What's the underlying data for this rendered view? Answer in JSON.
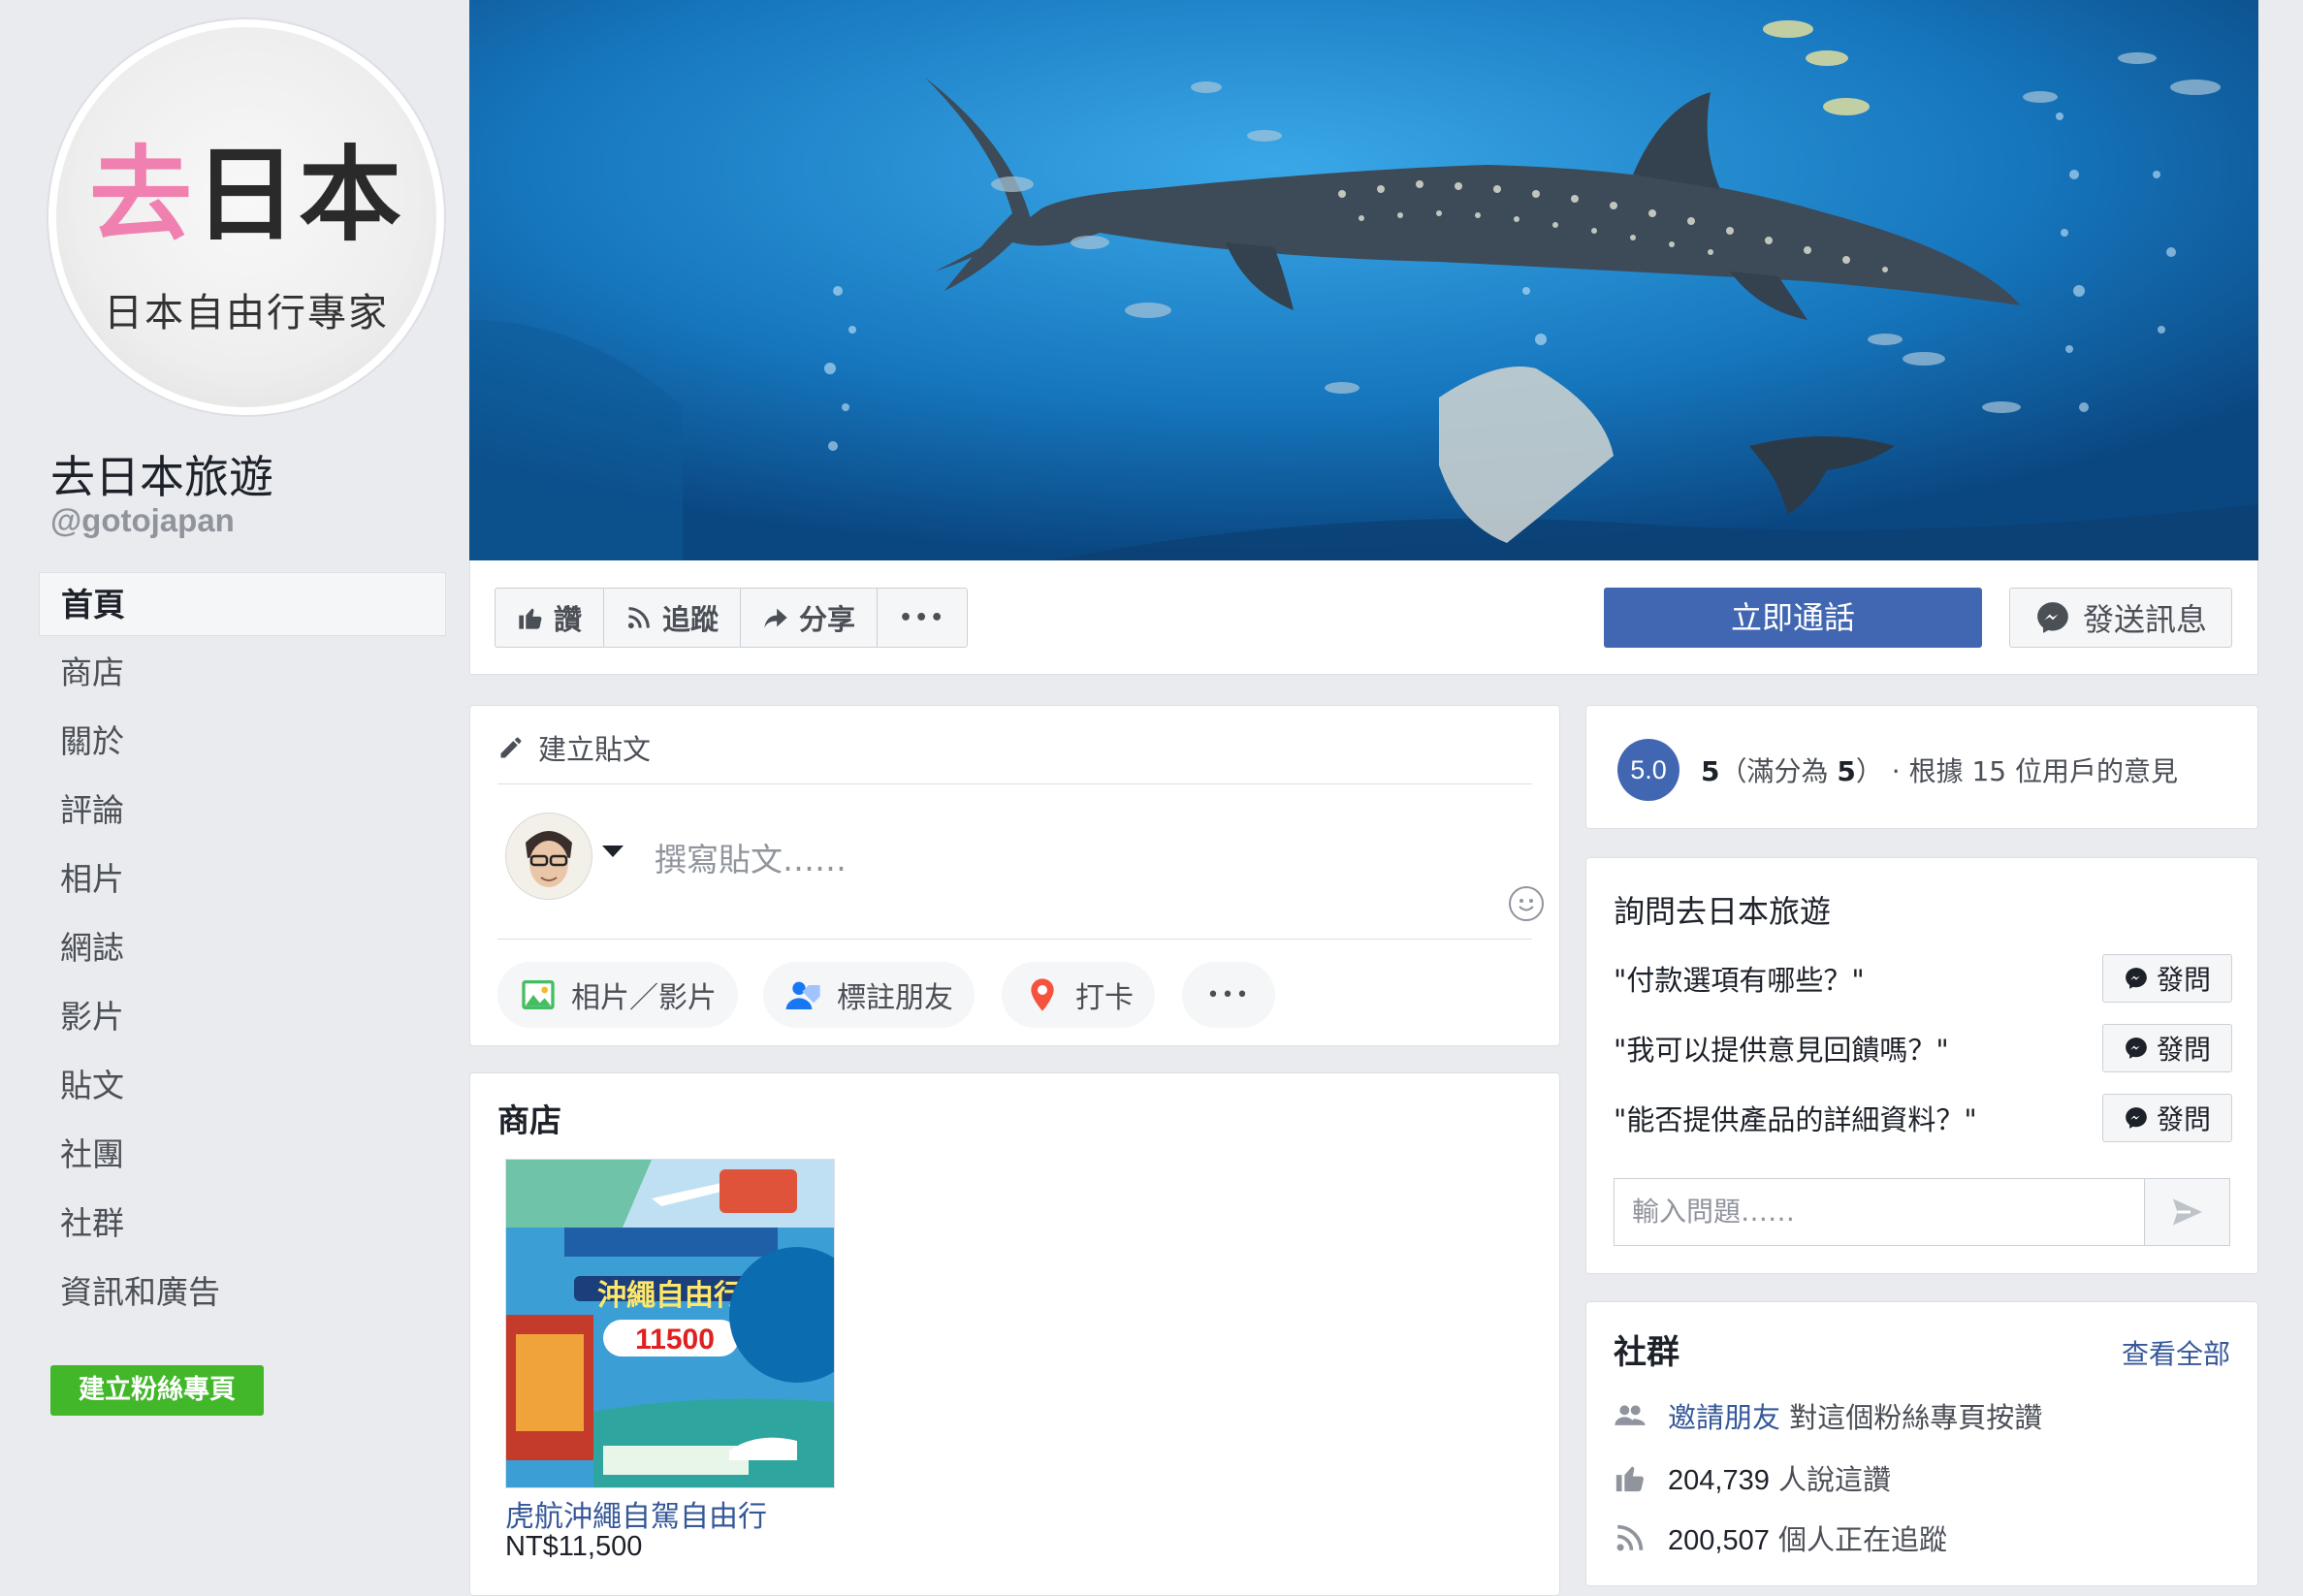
{
  "profile": {
    "logo_brand_pink": "去",
    "logo_brand_dark": "日本",
    "logo_tagline": "日本自由行專家",
    "name": "去日本旅遊",
    "handle": "@gotojapan"
  },
  "sidebar": {
    "items": [
      {
        "label": "首頁",
        "active": true
      },
      {
        "label": "商店"
      },
      {
        "label": "關於"
      },
      {
        "label": "評論"
      },
      {
        "label": "相片"
      },
      {
        "label": "網誌"
      },
      {
        "label": "影片"
      },
      {
        "label": "貼文"
      },
      {
        "label": "社團"
      },
      {
        "label": "社群"
      },
      {
        "label": "資訊和廣告"
      }
    ],
    "create_page_label": "建立粉絲專頁"
  },
  "actions": {
    "like": "讚",
    "follow": "追蹤",
    "share": "分享",
    "more": "•••",
    "call_now": "立即通話",
    "send_message": "發送訊息"
  },
  "composer": {
    "header": "建立貼文",
    "placeholder": "撰寫貼文……",
    "buttons": [
      "相片／影片",
      "標註朋友",
      "打卡"
    ],
    "more": "•••"
  },
  "shop": {
    "title": "商店",
    "product": {
      "name": "虎航沖繩自駕自由行",
      "price": "NT$11,500",
      "image_headline": "沖繩自由行",
      "image_price": "11500"
    }
  },
  "rating": {
    "score": "5.0",
    "value": "5",
    "text_prefix": "（滿分為 ",
    "max": "5",
    "text_suffix": "） · 根據 15 位用戶的意見"
  },
  "ask": {
    "title": "詢問去日本旅遊",
    "questions": [
      "\"付款選項有哪些？\"",
      "\"我可以提供意見回饋嗎？\"",
      "\"能否提供產品的詳細資料？\""
    ],
    "ask_button": "發問",
    "input_placeholder": "輸入問題……"
  },
  "community": {
    "title": "社群",
    "see_all": "查看全部",
    "invite_link": "邀請朋友",
    "invite_text": "對這個粉絲專頁按讚",
    "likes_count": "204,739",
    "likes_text": "人說這讚",
    "follow_count": "200,507",
    "follow_text": "個人正在追蹤"
  },
  "colors": {
    "brand_blue": "#4267b2",
    "link_blue": "#365899",
    "green": "#42b72a",
    "background": "#e9ebee"
  }
}
